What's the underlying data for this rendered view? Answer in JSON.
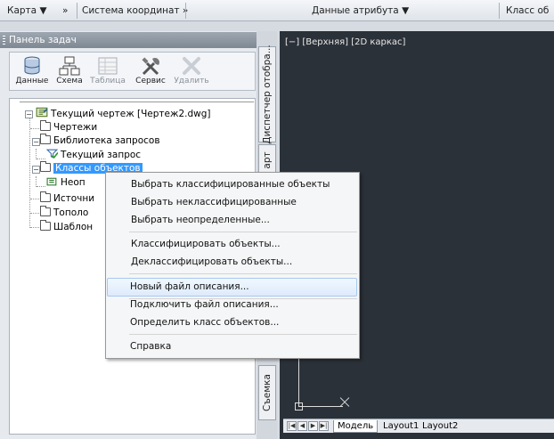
{
  "ribbon": {
    "items": [
      {
        "label": "Карта ▼"
      },
      {
        "label": "»"
      },
      {
        "label": "Система координат »"
      },
      {
        "label": "Данные атрибута ▼"
      },
      {
        "label": "Класс об"
      }
    ]
  },
  "taskpane": {
    "title": "Панель задач",
    "tools": [
      {
        "label": "Данные",
        "icon": "database-icon",
        "enabled": true
      },
      {
        "label": "Схема",
        "icon": "schema-icon",
        "enabled": true
      },
      {
        "label": "Таблица",
        "icon": "table-icon",
        "enabled": false
      },
      {
        "label": "Сервис",
        "icon": "tools-icon",
        "enabled": true
      },
      {
        "label": "Удалить",
        "icon": "delete-icon",
        "enabled": false
      }
    ],
    "tree": {
      "root": "Текущий чертеж [Чертеж2.dwg]",
      "drawings": "Чертежи",
      "query_library": "Библиотека запросов",
      "current_query": "Текущий запрос",
      "object_classes": "Классы объектов",
      "undefined": "Неоп",
      "sources": "Источни",
      "topology": "Тополо",
      "templates": "Шаблон"
    }
  },
  "vertical_tabs": {
    "display_manager": "Диспетчер отобра...",
    "map_explorer": "арт",
    "survey": "Съемка"
  },
  "viewport": {
    "label": "[−] [Верхняя] [2D каркас]",
    "background": "#2b3139"
  },
  "layout_tabs": [
    "Модель",
    "Layout1",
    "Layout2"
  ],
  "context_menu": {
    "items": [
      "Выбрать классифицированные объекты",
      "Выбрать неклассифицированные",
      "Выбрать неопределенные...",
      "Классифицировать объекты...",
      "Деклассифицировать объекты...",
      "Новый файл описания...",
      "Подключить файл описания...",
      "Определить класс объектов...",
      "Справка"
    ],
    "highlighted_index": 5
  }
}
